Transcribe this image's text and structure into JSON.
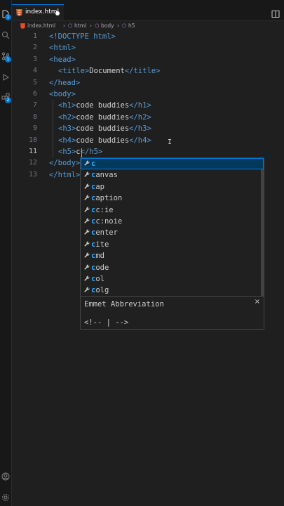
{
  "tab": {
    "filename": "index.html"
  },
  "breadcrumb": [
    "index.html",
    "html",
    "body",
    "h5"
  ],
  "activity_badges": {
    "source_control": "1",
    "extensions": "2"
  },
  "line_numbers": [
    "1",
    "2",
    "3",
    "4",
    "5",
    "6",
    "7",
    "8",
    "9",
    "10",
    "11",
    "12",
    "13"
  ],
  "code": {
    "l1_doctype": "<!DOCTYPE",
    "l1_html": "html",
    "l1_close": ">",
    "open_html": "<html>",
    "open_head": "<head>",
    "l4_open": "<title>",
    "l4_text": "Document",
    "l4_close": "</title>",
    "close_head": "</head>",
    "open_body": "<body>",
    "h1_open": "<h1>",
    "h1_text": "code buddies",
    "h1_close": "</h1>",
    "h2_open": "<h2>",
    "h2_text": "code buddies",
    "h2_close": "</h2>",
    "h3_open": "<h3>",
    "h3_text": "code buddies",
    "h3_close": "</h3>",
    "h4_open": "<h4>",
    "h4_text": "code buddies",
    "h4_close": "</h4>",
    "h5_open": "<h5>",
    "h5_text": "c",
    "h5_close": "</h5>",
    "close_body": "</body>",
    "close_html": "</html>"
  },
  "suggestions": [
    {
      "label": "c",
      "rest": ""
    },
    {
      "label": "c",
      "rest": "anvas"
    },
    {
      "label": "c",
      "rest": "ap"
    },
    {
      "label": "c",
      "rest": "aption"
    },
    {
      "label": "c",
      "rest": "c:ie"
    },
    {
      "label": "c",
      "rest": "c:noie"
    },
    {
      "label": "c",
      "rest": "enter"
    },
    {
      "label": "c",
      "rest": "ite"
    },
    {
      "label": "c",
      "rest": "md"
    },
    {
      "label": "c",
      "rest": "ode"
    },
    {
      "label": "c",
      "rest": "ol"
    },
    {
      "label": "c",
      "rest": "olg"
    }
  ],
  "details": {
    "title": "Emmet Abbreviation",
    "close": "×",
    "body": "<!-- | -->"
  },
  "colors": {
    "accent": "#0078d4",
    "tag": "#569cd6",
    "text": "#d4d4d4",
    "selection": "#04395e"
  }
}
